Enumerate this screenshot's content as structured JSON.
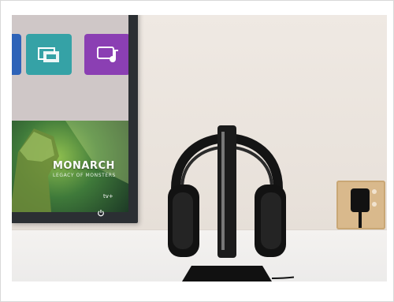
{
  "poster": {
    "title": "MONARCH",
    "subtitle": "LEGACY OF MONSTERS",
    "badge": "tv+"
  },
  "icons": {
    "tile_teal": "screen-mirror-icon",
    "tile_purple": "music-icon",
    "power": "power-icon"
  },
  "colors": {
    "tile_blue": "#2e63b8",
    "tile_teal": "#35a2a6",
    "tile_purple": "#8b3fb3",
    "socket": "#d9b98c",
    "headphones": "#151515"
  }
}
